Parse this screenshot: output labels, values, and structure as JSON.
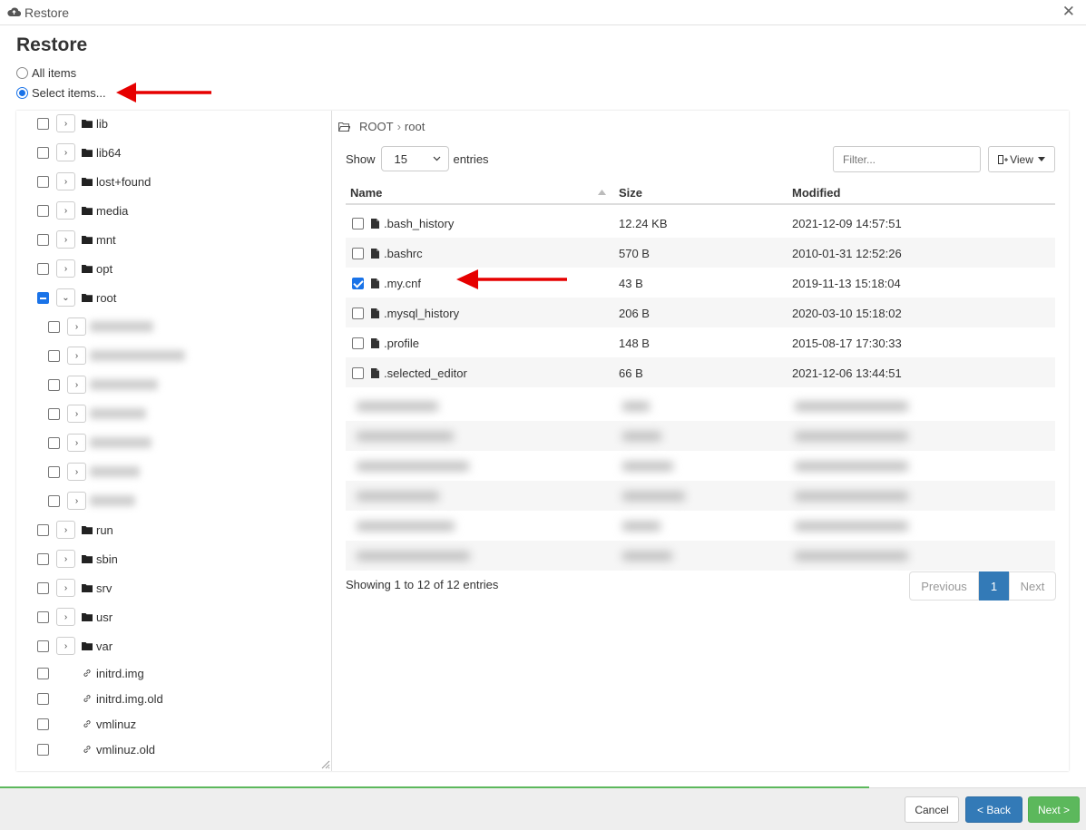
{
  "window": {
    "title": "Restore",
    "icon": "cloud-icon"
  },
  "heading": "Restore",
  "options": {
    "all": "All items",
    "select": "Select items...",
    "selected": "select"
  },
  "tree": {
    "items": [
      {
        "label": "lib",
        "type": "folder",
        "state": "unchecked",
        "expanded": false
      },
      {
        "label": "lib64",
        "type": "folder",
        "state": "unchecked",
        "expanded": false
      },
      {
        "label": "lost+found",
        "type": "folder",
        "state": "unchecked",
        "expanded": false
      },
      {
        "label": "media",
        "type": "folder",
        "state": "unchecked",
        "expanded": false
      },
      {
        "label": "mnt",
        "type": "folder",
        "state": "unchecked",
        "expanded": false
      },
      {
        "label": "opt",
        "type": "folder",
        "state": "unchecked",
        "expanded": false
      },
      {
        "label": "root",
        "type": "folder",
        "state": "partial",
        "expanded": true
      },
      {
        "label": "run",
        "type": "folder",
        "state": "unchecked",
        "expanded": false
      },
      {
        "label": "sbin",
        "type": "folder",
        "state": "unchecked",
        "expanded": false
      },
      {
        "label": "srv",
        "type": "folder",
        "state": "unchecked",
        "expanded": false
      },
      {
        "label": "usr",
        "type": "folder",
        "state": "unchecked",
        "expanded": false
      },
      {
        "label": "var",
        "type": "folder",
        "state": "unchecked",
        "expanded": false
      },
      {
        "label": "initrd.img",
        "type": "link",
        "state": "unchecked"
      },
      {
        "label": "initrd.img.old",
        "type": "link",
        "state": "unchecked"
      },
      {
        "label": "vmlinuz",
        "type": "link",
        "state": "unchecked"
      },
      {
        "label": "vmlinuz.old",
        "type": "link",
        "state": "unchecked"
      }
    ],
    "blurred_children_count": 7
  },
  "breadcrumb": {
    "root": "ROOT",
    "current": "root",
    "separator": "›"
  },
  "controls": {
    "show_label": "Show",
    "page_size": "15",
    "entries_label": "entries",
    "filter_placeholder": "Filter...",
    "view_label": "View"
  },
  "table": {
    "headers": {
      "name": "Name",
      "size": "Size",
      "modified": "Modified"
    },
    "rows": [
      {
        "name": ".bash_history",
        "size": "12.24 KB",
        "modified": "2021-12-09 14:57:51",
        "checked": false
      },
      {
        "name": ".bashrc",
        "size": "570 B",
        "modified": "2010-01-31 12:52:26",
        "checked": false
      },
      {
        "name": ".my.cnf",
        "size": "43 B",
        "modified": "2019-11-13 15:18:04",
        "checked": true
      },
      {
        "name": ".mysql_history",
        "size": "206 B",
        "modified": "2020-03-10 15:18:02",
        "checked": false
      },
      {
        "name": ".profile",
        "size": "148 B",
        "modified": "2015-08-17 17:30:33",
        "checked": false
      },
      {
        "name": ".selected_editor",
        "size": "66 B",
        "modified": "2021-12-06 13:44:51",
        "checked": false
      }
    ],
    "blurred_rows_count": 6
  },
  "info": "Showing 1 to 12 of 12 entries",
  "pager": {
    "previous": "Previous",
    "current": "1",
    "next": "Next"
  },
  "footer": {
    "cancel": "Cancel",
    "back": "< Back",
    "next": "Next >"
  },
  "colors": {
    "accent": "#337ab7",
    "success": "#5cb85c",
    "arrow": "#e60000",
    "checkbox": "#1a73e8"
  }
}
